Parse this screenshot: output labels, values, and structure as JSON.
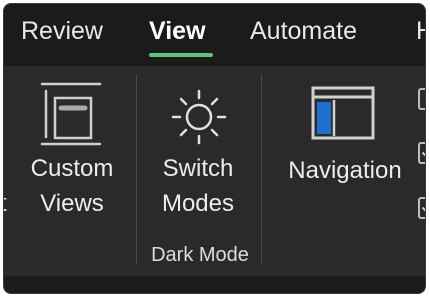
{
  "tabs": {
    "review": "Review",
    "view": "View",
    "automate": "Automate",
    "help_partial": "H"
  },
  "ribbon": {
    "cut_off_left_text": "t",
    "custom_views": {
      "line1": "Custom",
      "line2": "Views",
      "icon": "custom-views-icon"
    },
    "switch_modes": {
      "line1": "Switch",
      "line2": "Modes",
      "icon": "sun-icon"
    },
    "navigation": {
      "label": "Navigation",
      "icon": "navigation-pane-icon"
    },
    "group_label": "Dark Mode"
  },
  "colors": {
    "tab_bar": "#1b1b1b",
    "ribbon": "#2a2a2a",
    "active_underline": "#5cc47d",
    "navigation_blue": "#1f6fd1"
  }
}
